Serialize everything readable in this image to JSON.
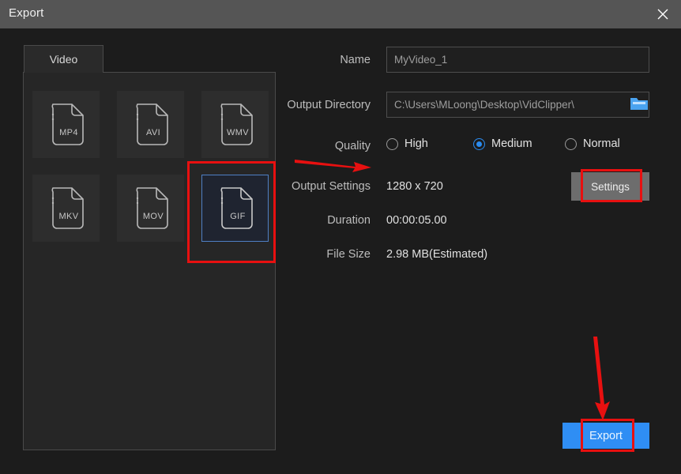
{
  "window": {
    "title": "Export",
    "close_icon": "close-icon"
  },
  "left_panel": {
    "tab_label": "Video",
    "formats": [
      {
        "ext": "MP4",
        "selected": false
      },
      {
        "ext": "AVI",
        "selected": false
      },
      {
        "ext": "WMV",
        "selected": false
      },
      {
        "ext": "MKV",
        "selected": false
      },
      {
        "ext": "MOV",
        "selected": false
      },
      {
        "ext": "GIF",
        "selected": true
      }
    ]
  },
  "form": {
    "name_label": "Name",
    "name_value": "MyVideo_1",
    "output_dir_label": "Output Directory",
    "output_dir_value": "C:\\Users\\MLoong\\Desktop\\VidClipper\\",
    "browse_icon": "folder-icon",
    "quality_label": "Quality",
    "quality_options": [
      {
        "label": "High",
        "selected": false
      },
      {
        "label": "Medium",
        "selected": true
      },
      {
        "label": "Normal",
        "selected": false
      }
    ],
    "output_settings_label": "Output Settings",
    "output_settings_value": "1280 x 720",
    "settings_button_label": "Settings",
    "duration_label": "Duration",
    "duration_value": "00:00:05.00",
    "file_size_label": "File Size",
    "file_size_value": "2.98 MB(Estimated)"
  },
  "actions": {
    "export_button_label": "Export"
  },
  "annotations": {
    "highlight_color": "#e81010",
    "accent_blue": "#2f8ef4",
    "titlebar_color": "#555555",
    "panel_color": "#262626",
    "background_color": "#1c1c1c"
  }
}
